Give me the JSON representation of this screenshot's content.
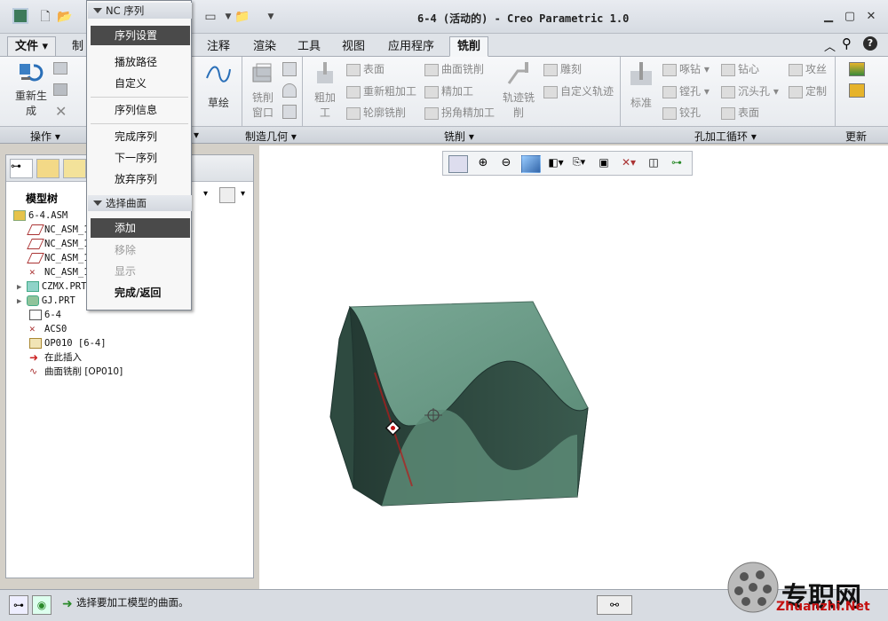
{
  "window": {
    "title": "6-4 (活动的) - Creo Parametric 1.0"
  },
  "tabs": [
    {
      "label": "文件"
    },
    {
      "label": "制"
    },
    {
      "label": "注释"
    },
    {
      "label": "渲染"
    },
    {
      "label": "工具"
    },
    {
      "label": "视图"
    },
    {
      "label": "应用程序"
    },
    {
      "label": "铣削"
    }
  ],
  "ribbon": {
    "operations": {
      "regenerate_line1": "重新生",
      "regenerate_line2": "成",
      "group_label": "操作"
    },
    "sketch_label": "草绘",
    "mfg_geometry": {
      "mill_window_line1": "铣削",
      "mill_window_line2": "窗口",
      "group_label": "制造几何"
    },
    "milling": {
      "rough_line1": "粗加",
      "rough_line2": "工",
      "face": "表面",
      "re_rough": "重新粗加工",
      "profile_mill": "轮廓铣削",
      "surface_mill": "曲面铣削",
      "finishing": "精加工",
      "corner_finish": "拐角精加工",
      "trajectory_line1": "轨迹铣",
      "trajectory_line2": "削",
      "engrave": "雕刻",
      "custom_trajectory": "自定义轨迹",
      "group_label": "铣削"
    },
    "holemaking": {
      "standard": "标准",
      "peck": "啄钻",
      "bore": "镗孔",
      "ream": "铰孔",
      "center_drill": "钻心",
      "countersink": "沉头孔",
      "face": "表面",
      "tap": "攻丝",
      "custom": "定制",
      "group_label": "孔加工循环"
    },
    "update": {
      "group_label": "更新"
    }
  },
  "menu": {
    "header1": "NC 序列",
    "items1": [
      "序列设置",
      "播放路径",
      "自定义",
      "序列信息",
      "完成序列",
      "下一序列",
      "放弃序列"
    ],
    "header2": "选择曲面",
    "items2": [
      "添加",
      "移除",
      "显示",
      "完成/返回"
    ]
  },
  "tree": {
    "title": "模型树",
    "rows": [
      "6-4.ASM",
      "NC_ASM_1",
      "NC_ASM_1",
      "NC_ASM_1",
      "NC_ASM_1",
      "CZMX.PRT",
      "GJ.PRT",
      "6-4",
      "ACS0",
      "OP010 [6-4]",
      "在此插入",
      "曲面铣削 [OP010]"
    ]
  },
  "status": {
    "message": "选择要加工模型的曲面。"
  },
  "watermark": {
    "text": "专职网",
    "url": "Zhuanzhi.Net"
  },
  "colors": {
    "model_face": "#6ea08a",
    "model_dark": "#2f4a40",
    "selection": "#4a4a4a",
    "accent": "#b81a1a"
  }
}
